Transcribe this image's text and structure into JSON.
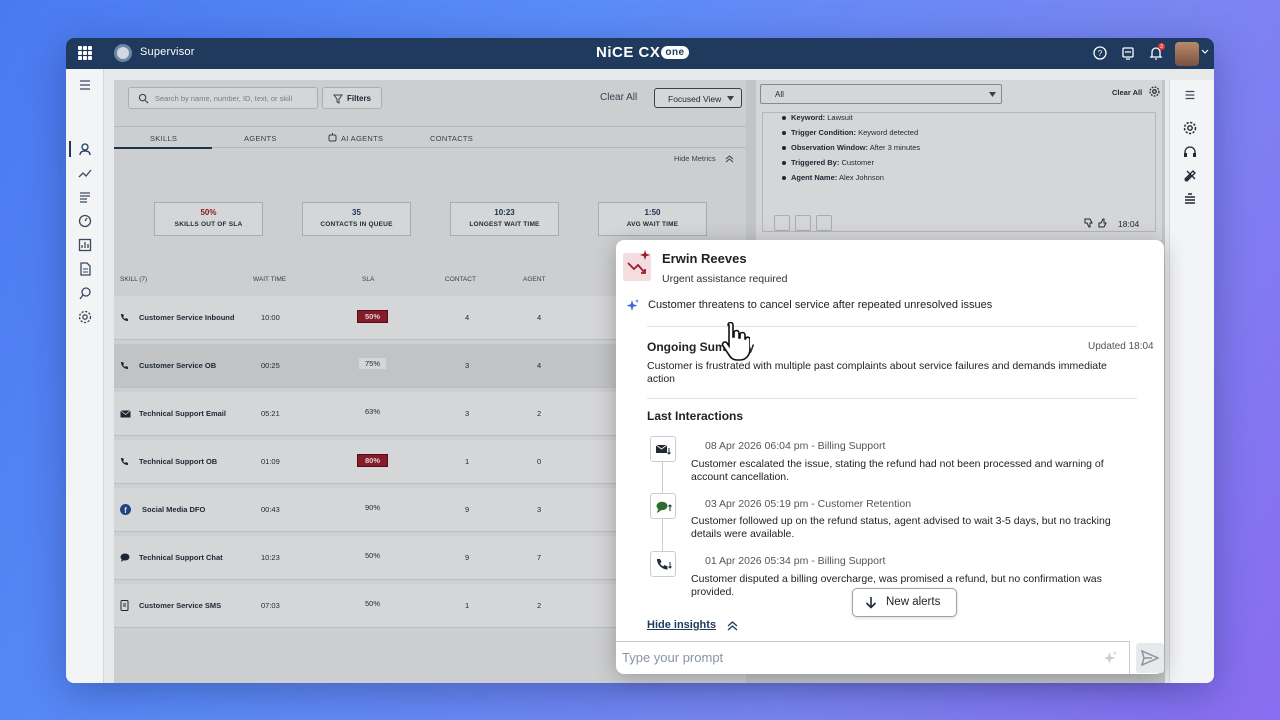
{
  "topbar": {
    "app_title": "Supervisor",
    "brand": "NiCE CX",
    "brand_suffix": "one",
    "notification_count": "3"
  },
  "toolbar": {
    "search_placeholder": "Search by name, number, ID, text, or skill",
    "filters_label": "Filters",
    "clear_all": "Clear All",
    "view_label": "Focused View"
  },
  "tabs": [
    {
      "label": "SKILLS"
    },
    {
      "label": "AGENTS"
    },
    {
      "label": "AI AGENTS"
    },
    {
      "label": "CONTACTS"
    }
  ],
  "hide_metrics": "Hide Metrics",
  "metrics": [
    {
      "value": "50%",
      "label": "SKILLS OUT OF SLA"
    },
    {
      "value": "35",
      "label": "CONTACTS IN QUEUE"
    },
    {
      "value": "10:23",
      "label": "LONGEST WAIT TIME"
    },
    {
      "value": "1:50",
      "label": "AVG WAIT TIME"
    }
  ],
  "table": {
    "headers": [
      "SKILL (7)",
      "WAIT TIME",
      "SLA",
      "CONTACT",
      "AGENT"
    ],
    "rows": [
      {
        "skill": "Customer Service Inbound",
        "wait": "10:00",
        "sla": "50%",
        "contact": "4",
        "agent": "4"
      },
      {
        "skill": "Customer Service OB",
        "wait": "00:25",
        "sla": "75%",
        "contact": "3",
        "agent": "4"
      },
      {
        "skill": "Technical Support Email",
        "wait": "05:21",
        "sla": "63%",
        "contact": "3",
        "agent": "2"
      },
      {
        "skill": "Technical Support OB",
        "wait": "01:09",
        "sla": "80%",
        "contact": "1",
        "agent": "0"
      },
      {
        "skill": "Social Media DFO",
        "wait": "00:43",
        "sla": "90%",
        "contact": "9",
        "agent": "3"
      },
      {
        "skill": "Technical Support Chat",
        "wait": "10:23",
        "sla": "50%",
        "contact": "9",
        "agent": "7"
      },
      {
        "skill": "Customer Service SMS",
        "wait": "07:03",
        "sla": "50%",
        "contact": "1",
        "agent": "2"
      }
    ]
  },
  "alerts_panel": {
    "filter_value": "All",
    "clear_all": "Clear All",
    "details": [
      {
        "key": "Keyword:",
        "value": "Lawsuit"
      },
      {
        "key": "Trigger Condition:",
        "value": "Keyword detected"
      },
      {
        "key": "Observation Window:",
        "value": "After 3 minutes"
      },
      {
        "key": "Triggered By:",
        "value": "Customer"
      },
      {
        "key": "Agent Name:",
        "value": "Alex Johnson"
      }
    ],
    "time": "18:04"
  },
  "insight": {
    "name": "Erwin Reeves",
    "status": "Urgent assistance required",
    "threat": "Customer threatens to cancel service after repeated unresolved issues",
    "summary_title": "Ongoing Summary",
    "updated": "Updated 18:04",
    "summary": "Customer is frustrated with multiple past complaints about service failures and demands immediate action",
    "last_title": "Last Interactions",
    "interactions": [
      {
        "date": "08 Apr 2026 06:04 pm - Billing Support",
        "text": "Customer escalated the issue, stating the refund had not been processed and warning of account cancellation."
      },
      {
        "date": "03 Apr 2026 05:19 pm - Customer Retention",
        "text": "Customer followed up on the refund status, agent advised to wait 3-5 days, but no tracking details were available."
      },
      {
        "date": "01 Apr 2026 05:34 pm - Billing Support",
        "text": "Customer disputed a billing overcharge, was promised a refund, but no confirmation was provided."
      }
    ],
    "new_alerts": "New alerts",
    "hide_insights": "Hide insights",
    "prompt_placeholder": "Type your prompt"
  },
  "colors": {
    "topbar": "#1f3a5c",
    "sla_breach": "#a01c2b",
    "accent": "#1f3a5c"
  }
}
